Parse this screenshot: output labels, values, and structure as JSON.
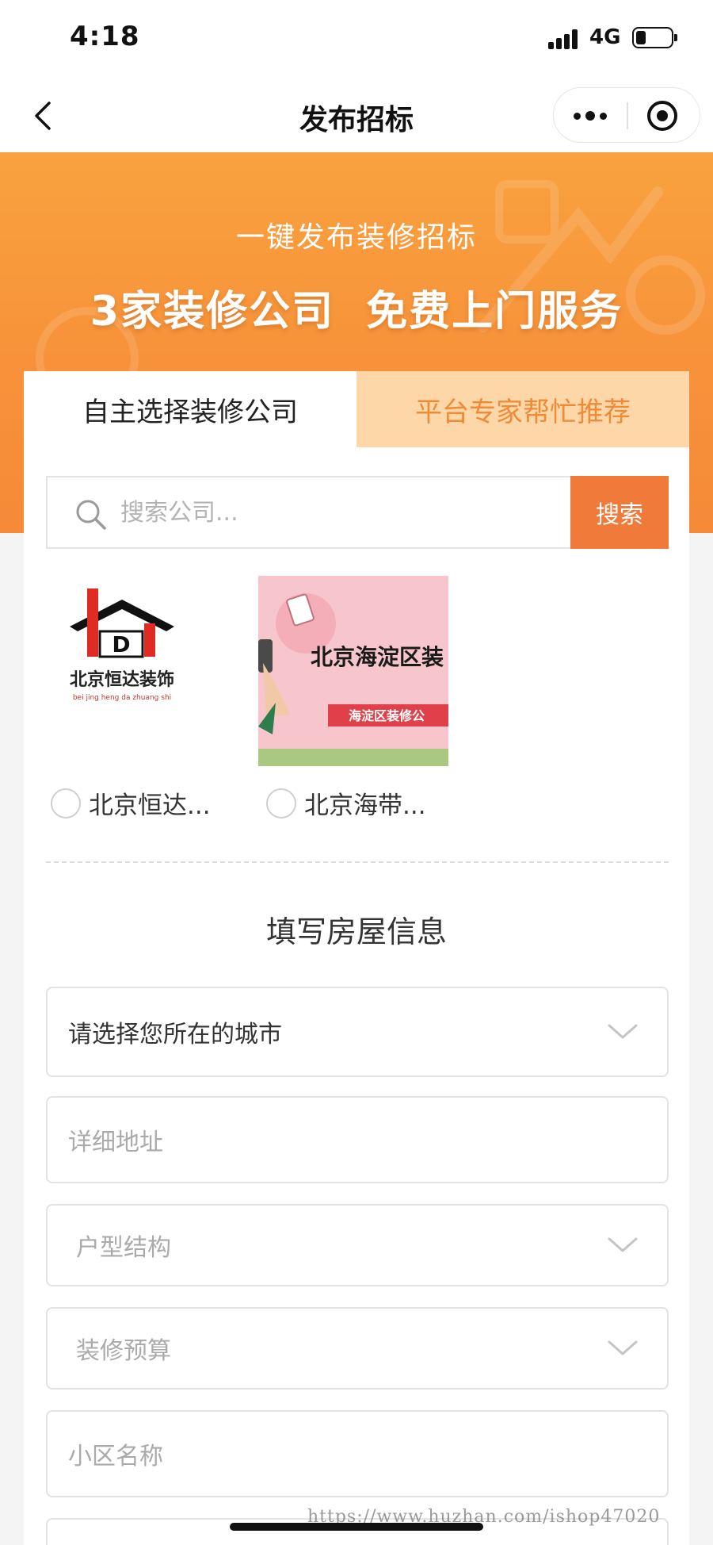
{
  "status_bar": {
    "time": "4:18",
    "network": "4G"
  },
  "nav": {
    "title": "发布招标",
    "back_icon": "chevron-left-icon",
    "more_icon": "more-dots-icon",
    "close_icon": "target-close-icon"
  },
  "banner": {
    "subtitle": "一键发布装修招标",
    "headline_left": "3家装修公司",
    "headline_right": "免费上门服务"
  },
  "tabs": {
    "self_select": "自主选择装修公司",
    "expert_recommend": "平台专家帮忙推荐"
  },
  "search": {
    "placeholder": "搜索公司...",
    "button_label": "搜索"
  },
  "companies": [
    {
      "name": "北京恒达...",
      "logo_title": "北京恒达装饰",
      "logo_subtitle": "bei jing heng da zhuang shi",
      "logo_initial": "D"
    },
    {
      "name": "北京海带...",
      "logo_title": "北京海淀区装",
      "logo_subtitle": "海淀区装修公"
    }
  ],
  "form": {
    "section_title": "填写房屋信息",
    "city": "请选择您所在的城市",
    "address_placeholder": "详细地址",
    "house_type_placeholder": "户型结构",
    "budget_placeholder": "装修预算",
    "community_placeholder": "小区名称"
  },
  "watermark": "https://www.huzhan.com/ishop47020",
  "colors": {
    "accent_orange": "#f07a3a",
    "banner_orange": "#f7923a",
    "tab_inactive_bg": "#fdd7a8",
    "tab_inactive_text": "#f08a36"
  }
}
